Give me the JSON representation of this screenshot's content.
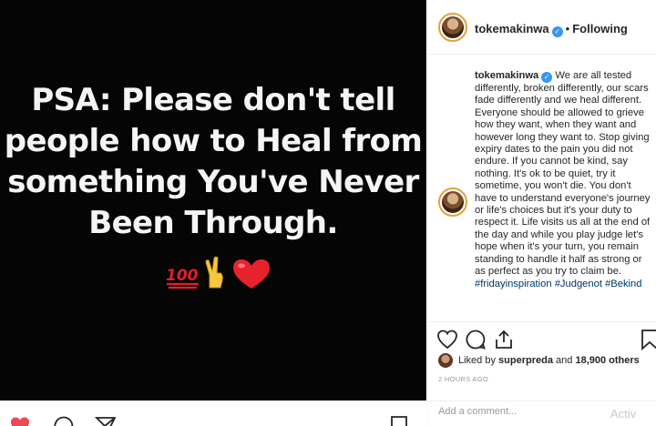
{
  "post": {
    "text_lines": [
      "PSA: Please don't tell",
      "people how to Heal from",
      "something You've Never",
      "Been Through."
    ],
    "emojis": [
      "hundred-points-icon",
      "victory-hand-icon",
      "red-heart-icon"
    ]
  },
  "header": {
    "username": "tokemakinwa",
    "separator": "•",
    "follow_state": "Following"
  },
  "caption": {
    "username": "tokemakinwa",
    "body": "We are all tested differently, broken differently, our scars fade differently and we heal different. Everyone should be allowed to grieve how they want, when they want and however long they want to. Stop giving expiry dates to the pain you did not endure. If you cannot be kind, say nothing. It's ok to be quiet, try it sometime, you won't die. You don't have to understand everyone's journey or life's choices but it's your duty to respect it. Life visits us all at the end of the day and while you play judge let's hope when it's your turn, you remain standing to handle it half as strong or as perfect as you try to claim be.",
    "hashtags": [
      "#fridayinspiration",
      "#Judgenot",
      "#Bekind"
    ]
  },
  "likes": {
    "prefix": "Liked by",
    "liker": "superpreda",
    "middle": "and",
    "others": "18,900 others"
  },
  "timestamp": "2 HOURS AGO",
  "comment": {
    "placeholder": "Add a comment..."
  },
  "watermark": "Activ",
  "colors": {
    "verified": "#3897f0",
    "hashtag": "#003569",
    "like_red": "#ed4956",
    "avatar_ring": "#e3a13a"
  }
}
